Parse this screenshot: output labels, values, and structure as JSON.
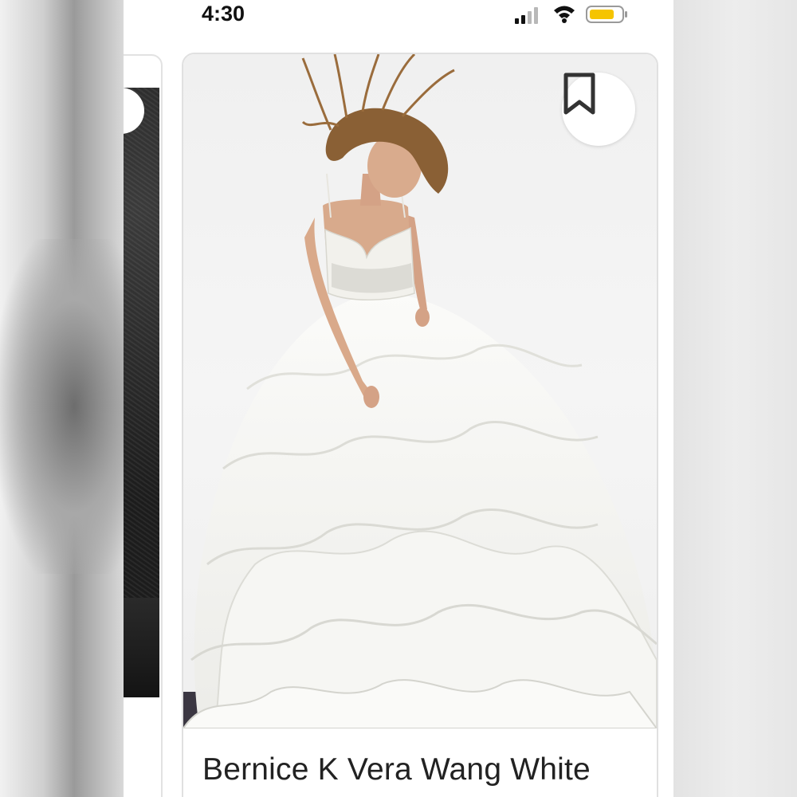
{
  "status_bar": {
    "time": "4:30",
    "icons": [
      "signal-icon",
      "wifi-icon",
      "battery-icon"
    ],
    "battery_color": "#f5c400"
  },
  "product": {
    "title": "Bernice K Vera Wang White",
    "image": "wedding-gown-photo",
    "bookmark_icon": "bookmark-icon"
  },
  "colors": {
    "card_border": "#e0e0e0",
    "text": "#222222"
  }
}
